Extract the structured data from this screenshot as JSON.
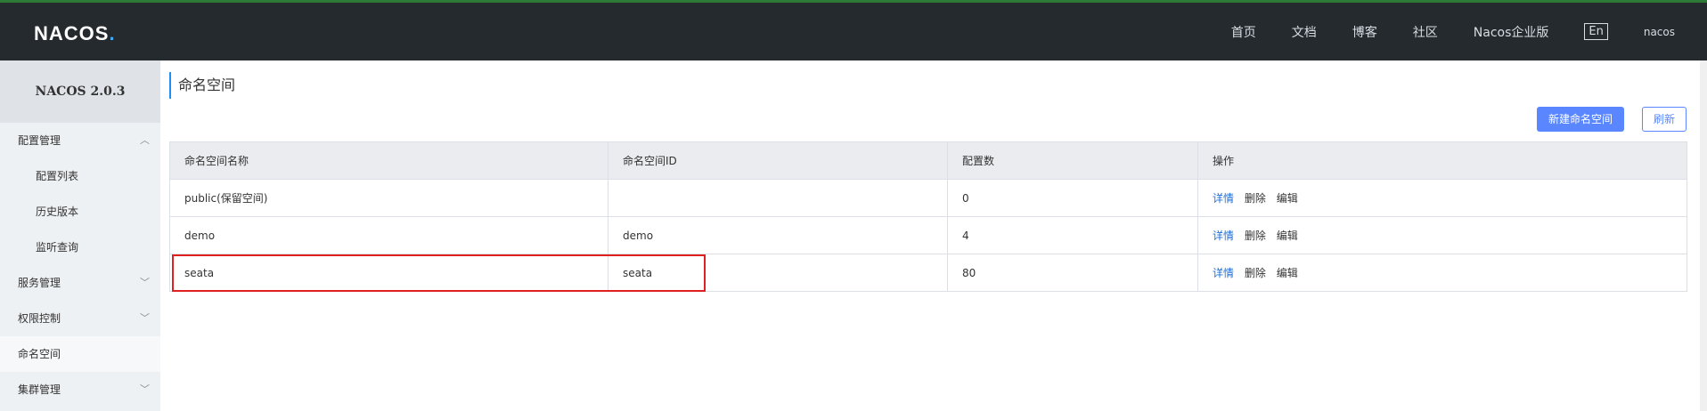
{
  "topbar": {
    "logo": "NACOS",
    "logo_dot": ".",
    "nav": [
      "首页",
      "文档",
      "博客",
      "社区",
      "Nacos企业版"
    ],
    "lang": "En",
    "user": "nacos"
  },
  "sidebar": {
    "title": "NACOS 2.0.3",
    "items": [
      {
        "label": "配置管理"
      },
      {
        "label": "配置列表"
      },
      {
        "label": "历史版本"
      },
      {
        "label": "监听查询"
      },
      {
        "label": "服务管理"
      },
      {
        "label": "权限控制"
      },
      {
        "label": "命名空间"
      },
      {
        "label": "集群管理"
      }
    ]
  },
  "main": {
    "title": "命名空间",
    "new_button": "新建命名空间",
    "refresh_button": "刷新",
    "columns": [
      "命名空间名称",
      "命名空间ID",
      "配置数",
      "操作"
    ],
    "rows": [
      {
        "name": "public(保留空间)",
        "id": "",
        "count": "0"
      },
      {
        "name": "demo",
        "id": "demo",
        "count": "4"
      },
      {
        "name": "seata",
        "id": "seata",
        "count": "80"
      }
    ],
    "actions": {
      "detail": "详情",
      "delete": "删除",
      "edit": "编辑"
    }
  }
}
